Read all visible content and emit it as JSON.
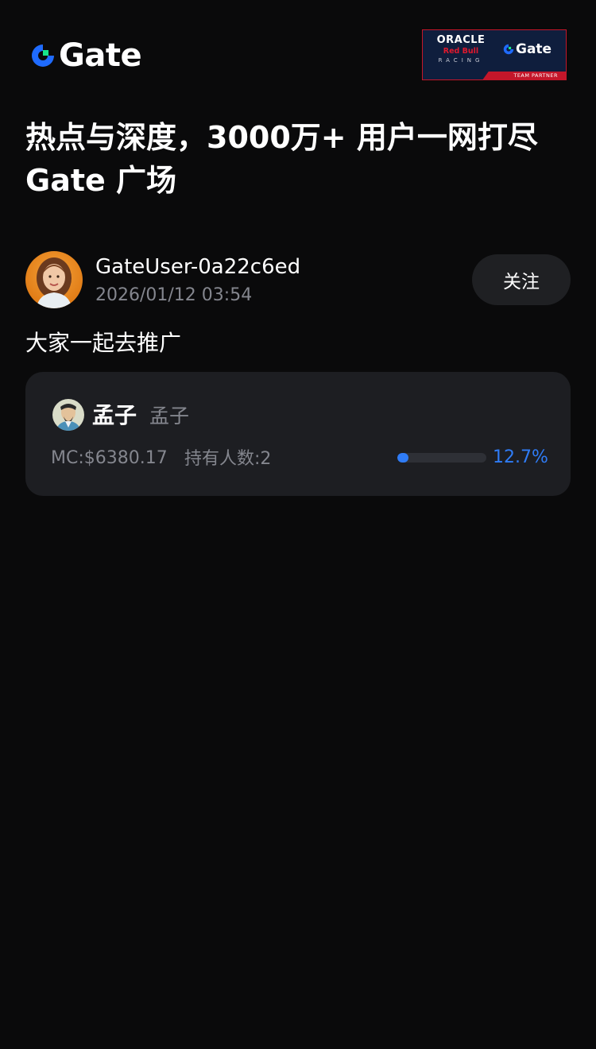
{
  "brand": {
    "logo_text": "Gate",
    "accent": "#2f7cf6",
    "logo_green": "#17e58c",
    "logo_blue": "#1f6bff"
  },
  "partner_badge": {
    "oracle": "ORACLE",
    "redbull": "Red Bull",
    "racing": "RACING",
    "gate": "Gate",
    "team_partner": "TEAM PARTNER"
  },
  "headline": "热点与深度，3000万+ 用户一网打尽 Gate 广场",
  "post": {
    "username": "GateUser-0a22c6ed",
    "timestamp": "2026/01/12 03:54",
    "follow_label": "关注",
    "text": "大家一起去推广",
    "token": {
      "name": "孟子",
      "ticker": "孟子",
      "market_cap": "MC:$6380.17",
      "holders": "持有人数:2",
      "progress_label": "12.7%",
      "progress_value": 0.127
    }
  }
}
